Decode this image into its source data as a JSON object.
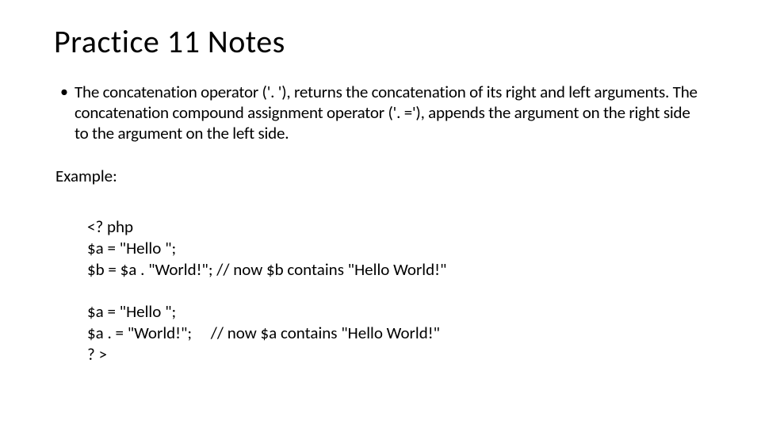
{
  "title": "Practice 11 Notes",
  "bullet": {
    "text": "The concatenation operator ('. '), returns the concatenation of its right and left arguments. The concatenation compound assignment operator ('. ='), appends the argument on the right side to the argument on the left side."
  },
  "example_label": "Example:",
  "code": {
    "line1": "<? php",
    "line2": "$a = \"Hello \";",
    "line3": "$b = $a . \"World!\"; // now $b contains \"Hello World!\"",
    "line4": "$a = \"Hello \";",
    "line5": "$a . = \"World!\";     // now $a contains \"Hello World!\"",
    "line6": "? >"
  }
}
